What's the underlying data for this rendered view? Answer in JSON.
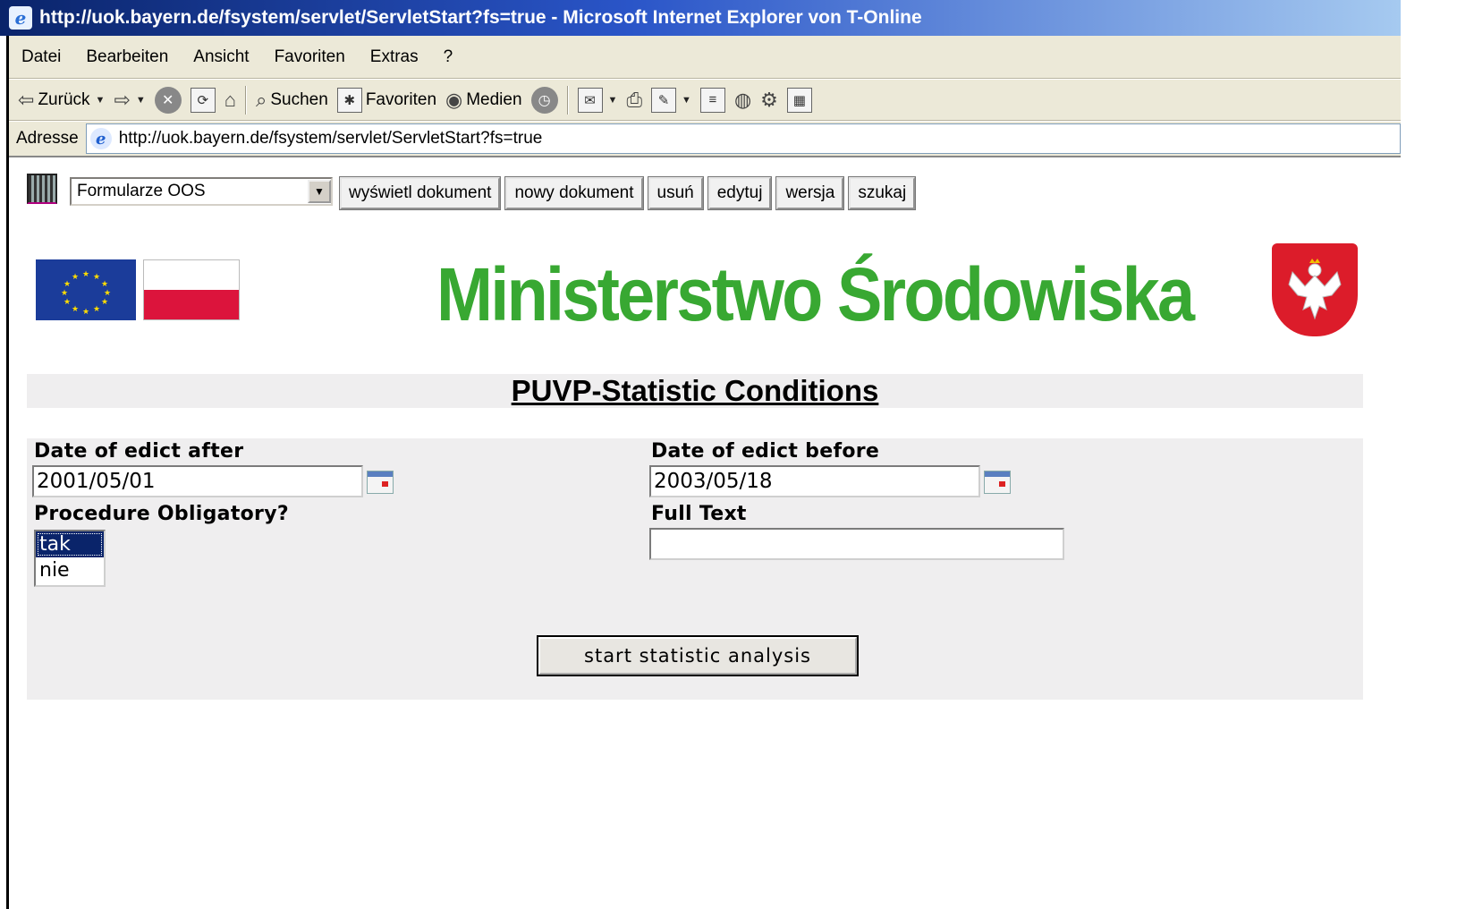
{
  "window": {
    "title": "http://uok.bayern.de/fsystem/servlet/ServletStart?fs=true - Microsoft Internet Explorer von T-Online"
  },
  "menu": [
    "Datei",
    "Bearbeiten",
    "Ansicht",
    "Favoriten",
    "Extras",
    "?"
  ],
  "toolbar": {
    "back_label": "Zurück",
    "search_label": "Suchen",
    "favorites_label": "Favoriten",
    "media_label": "Medien"
  },
  "address": {
    "label": "Adresse",
    "url": "http://uok.bayern.de/fsystem/servlet/ServletStart?fs=true"
  },
  "app": {
    "form_select_value": "Formularze OOS",
    "buttons": [
      "wyświetl dokument",
      "nowy dokument",
      "usuń",
      "edytuj",
      "wersja",
      "szukaj"
    ]
  },
  "header": {
    "ministry": "Ministerstwo Środowiska"
  },
  "form": {
    "section_title": "PUVP-Statistic Conditions",
    "date_after_label": "Date of edict after",
    "date_after_value": "2001/05/01",
    "date_before_label": "Date of edict before",
    "date_before_value": "2003/05/18",
    "procedure_label": "Procedure Obligatory?",
    "procedure_options": [
      "tak",
      "nie"
    ],
    "procedure_selected": "tak",
    "fulltext_label": "Full Text",
    "fulltext_value": "",
    "submit_label": "start statistic analysis"
  },
  "colors": {
    "ministry_green": "#38a832",
    "titlebar_blue": "#0a246a",
    "panel_gray": "#efeeef"
  }
}
